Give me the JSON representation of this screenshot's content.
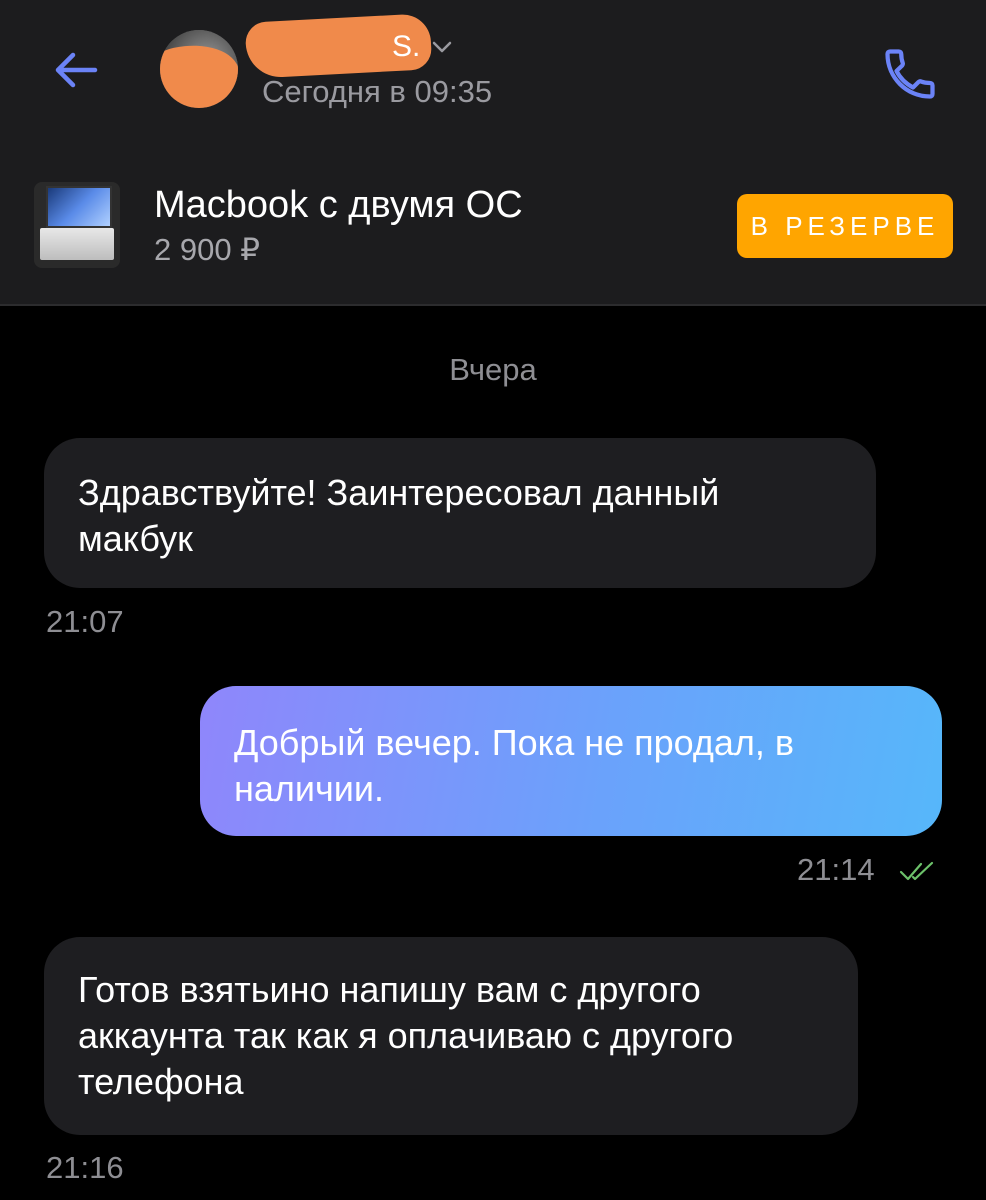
{
  "header": {
    "contact_name": "S.",
    "last_seen": "Сегодня в 09:35",
    "icons": {
      "back": "arrow-left-icon",
      "call": "phone-icon",
      "chevron": "chevron-down-icon"
    },
    "accent_color": "#6b83f7"
  },
  "product": {
    "title": "Macbook с двумя ОС",
    "price": "2 900 ₽",
    "status_badge": "В РЕЗЕРВЕ",
    "badge_color": "#ffa500"
  },
  "chat": {
    "day_separator": "Вчера",
    "messages": [
      {
        "direction": "incoming",
        "text": "Здравствуйте! Заинтересовал данный макбук",
        "time": "21:07"
      },
      {
        "direction": "outgoing",
        "text": "Добрый вечер. Пока не продал, в наличии.",
        "time": "21:14",
        "read": true
      },
      {
        "direction": "incoming",
        "text": "Готов взятьино напишу вам с другого аккаунта так как я оплачиваю с другого телефона",
        "time": "21:16"
      }
    ]
  }
}
